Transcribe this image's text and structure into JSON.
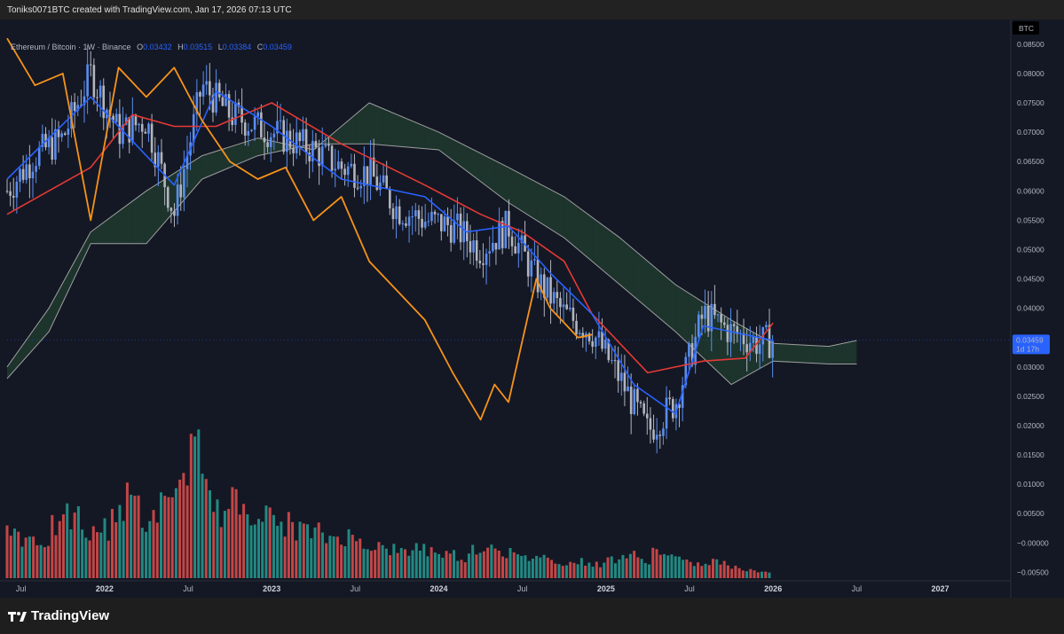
{
  "header": {
    "caption": "Toniks0071BTC created with TradingView.com, Jan 17, 2026 07:13 UTC"
  },
  "legend": {
    "symbol": "Ethereum / Bitcoin · 1W · Binance",
    "o_label": "O",
    "o": "0.03432",
    "h_label": "H",
    "h": "0.03515",
    "l_label": "L",
    "l": "0.03384",
    "c_label": "C",
    "c": "0.03459"
  },
  "price_axis": {
    "currency": "BTC",
    "ticks": [
      "0.08500",
      "0.08000",
      "0.07500",
      "0.07000",
      "0.06500",
      "0.06000",
      "0.05500",
      "0.05000",
      "0.04500",
      "0.04000",
      "0.03500",
      "0.03000",
      "0.02500",
      "0.02000",
      "0.01500",
      "0.01000",
      "0.00500",
      "−0.00000",
      "−0.00500"
    ],
    "last_price_label": "0.03459",
    "countdown_label": "1d 17h"
  },
  "time_axis": {
    "ticks": [
      {
        "label": "Jul",
        "year": false
      },
      {
        "label": "2022",
        "year": true
      },
      {
        "label": "Jul",
        "year": false
      },
      {
        "label": "2023",
        "year": true
      },
      {
        "label": "Jul",
        "year": false
      },
      {
        "label": "2024",
        "year": true
      },
      {
        "label": "Jul",
        "year": false
      },
      {
        "label": "2025",
        "year": true
      },
      {
        "label": "Jul",
        "year": false
      },
      {
        "label": "2026",
        "year": true
      },
      {
        "label": "Jul",
        "year": false
      },
      {
        "label": "2027",
        "year": true
      }
    ]
  },
  "footer": {
    "brand": "TradingView"
  },
  "colors": {
    "bg": "#141824",
    "up": "#5b8def",
    "down": "#b2b5be",
    "tenkan": "#2962ff",
    "kijun": "#e53935",
    "chikou": "#f7931a",
    "span_line": "#9e9e9e",
    "kumo_bull": "#1e3a2f",
    "kumo_bear": "#4a2431",
    "vol_up": "#26a69a",
    "vol_down": "#ef5350",
    "price_tag": "#2962ff"
  },
  "chart_data": {
    "type": "candlestick-ichimoku",
    "title": "Ethereum / Bitcoin · 1W · Binance",
    "ylabel": "BTC",
    "ylim": [
      -0.006,
      0.088
    ],
    "x_range": [
      "2021-06",
      "2027-06"
    ],
    "last": {
      "open": 0.03432,
      "high": 0.03515,
      "low": 0.03384,
      "close": 0.03459
    },
    "close_path": [
      [
        "2021-06",
        0.06
      ],
      [
        "2021-08",
        0.066
      ],
      [
        "2021-10",
        0.069
      ],
      [
        "2021-12",
        0.08
      ],
      [
        "2022-02",
        0.07
      ],
      [
        "2022-04",
        0.072
      ],
      [
        "2022-06",
        0.056
      ],
      [
        "2022-08",
        0.078
      ],
      [
        "2022-10",
        0.073
      ],
      [
        "2022-12",
        0.071
      ],
      [
        "2023-02",
        0.069
      ],
      [
        "2023-04",
        0.067
      ],
      [
        "2023-06",
        0.064
      ],
      [
        "2023-08",
        0.063
      ],
      [
        "2023-10",
        0.057
      ],
      [
        "2023-12",
        0.055
      ],
      [
        "2024-02",
        0.054
      ],
      [
        "2024-04",
        0.05
      ],
      [
        "2024-06",
        0.054
      ],
      [
        "2024-08",
        0.045
      ],
      [
        "2024-10",
        0.039
      ],
      [
        "2024-12",
        0.036
      ],
      [
        "2025-02",
        0.028
      ],
      [
        "2025-04",
        0.019
      ],
      [
        "2025-06",
        0.024
      ],
      [
        "2025-08",
        0.039
      ],
      [
        "2025-10",
        0.036
      ],
      [
        "2025-12",
        0.034
      ],
      [
        "2026-01",
        0.0346
      ]
    ],
    "tenkan": [
      [
        "2021-06",
        0.062
      ],
      [
        "2021-12",
        0.076
      ],
      [
        "2022-06",
        0.061
      ],
      [
        "2022-09",
        0.077
      ],
      [
        "2023-01",
        0.071
      ],
      [
        "2023-06",
        0.062
      ],
      [
        "2023-12",
        0.059
      ],
      [
        "2024-03",
        0.053
      ],
      [
        "2024-06",
        0.054
      ],
      [
        "2024-09",
        0.046
      ],
      [
        "2024-12",
        0.039
      ],
      [
        "2025-03",
        0.027
      ],
      [
        "2025-06",
        0.022
      ],
      [
        "2025-08",
        0.037
      ],
      [
        "2025-10",
        0.036
      ],
      [
        "2026-01",
        0.0345
      ]
    ],
    "kijun": [
      [
        "2021-06",
        0.056
      ],
      [
        "2021-12",
        0.064
      ],
      [
        "2022-03",
        0.073
      ],
      [
        "2022-06",
        0.071
      ],
      [
        "2022-09",
        0.071
      ],
      [
        "2023-01",
        0.075
      ],
      [
        "2023-06",
        0.068
      ],
      [
        "2023-12",
        0.061
      ],
      [
        "2024-04",
        0.056
      ],
      [
        "2024-07",
        0.053
      ],
      [
        "2024-10",
        0.048
      ],
      [
        "2024-12",
        0.039
      ],
      [
        "2025-04",
        0.029
      ],
      [
        "2025-08",
        0.031
      ],
      [
        "2025-11",
        0.0315
      ],
      [
        "2026-01",
        0.0375
      ]
    ],
    "chikou": [
      [
        "2021-06",
        0.086
      ],
      [
        "2021-08",
        0.078
      ],
      [
        "2021-10",
        0.08
      ],
      [
        "2021-12",
        0.055
      ],
      [
        "2022-02",
        0.081
      ],
      [
        "2022-04",
        0.076
      ],
      [
        "2022-06",
        0.081
      ],
      [
        "2022-08",
        0.072
      ],
      [
        "2022-10",
        0.065
      ],
      [
        "2022-12",
        0.062
      ],
      [
        "2023-02",
        0.064
      ],
      [
        "2023-04",
        0.055
      ],
      [
        "2023-06",
        0.059
      ],
      [
        "2023-08",
        0.048
      ],
      [
        "2023-10",
        0.043
      ],
      [
        "2023-12",
        0.038
      ],
      [
        "2024-02",
        0.029
      ],
      [
        "2024-04",
        0.021
      ],
      [
        "2024-05",
        0.027
      ],
      [
        "2024-06",
        0.024
      ],
      [
        "2024-08",
        0.045
      ],
      [
        "2024-09",
        0.04
      ],
      [
        "2024-11",
        0.035
      ],
      [
        "2024-12",
        0.0355
      ]
    ],
    "senkou_a": [
      [
        "2021-06",
        0.03
      ],
      [
        "2021-09",
        0.04
      ],
      [
        "2021-12",
        0.053
      ],
      [
        "2022-04",
        0.06
      ],
      [
        "2022-08",
        0.066
      ],
      [
        "2022-12",
        0.069
      ],
      [
        "2023-04",
        0.067
      ],
      [
        "2023-08",
        0.075
      ],
      [
        "2024-01",
        0.07
      ],
      [
        "2024-06",
        0.064
      ],
      [
        "2024-10",
        0.059
      ],
      [
        "2025-02",
        0.052
      ],
      [
        "2025-06",
        0.044
      ],
      [
        "2025-10",
        0.038
      ],
      [
        "2026-01",
        0.034
      ],
      [
        "2026-05",
        0.0335
      ],
      [
        "2026-07",
        0.0345
      ]
    ],
    "senkou_b": [
      [
        "2021-06",
        0.028
      ],
      [
        "2021-09",
        0.036
      ],
      [
        "2021-12",
        0.051
      ],
      [
        "2022-04",
        0.051
      ],
      [
        "2022-08",
        0.062
      ],
      [
        "2022-12",
        0.066
      ],
      [
        "2023-04",
        0.068
      ],
      [
        "2023-08",
        0.068
      ],
      [
        "2024-01",
        0.067
      ],
      [
        "2024-06",
        0.058
      ],
      [
        "2024-10",
        0.052
      ],
      [
        "2025-02",
        0.044
      ],
      [
        "2025-06",
        0.036
      ],
      [
        "2025-10",
        0.027
      ],
      [
        "2026-01",
        0.031
      ],
      [
        "2026-05",
        0.0305
      ],
      [
        "2026-07",
        0.0305
      ]
    ],
    "volume_relative": [
      0.31,
      0.27,
      0.25,
      0.34,
      0.4,
      0.29,
      0.33,
      0.45,
      0.52,
      0.38,
      0.47,
      0.62,
      0.81,
      0.58,
      0.43,
      0.49,
      0.46,
      0.4,
      0.36,
      0.33,
      0.3,
      0.27,
      0.28,
      0.25,
      0.22,
      0.19,
      0.17,
      0.21,
      0.18,
      0.16,
      0.14,
      0.2,
      0.22,
      0.17,
      0.13,
      0.15,
      0.12,
      0.1,
      0.11,
      0.09,
      0.13,
      0.15,
      0.12,
      0.18,
      0.14,
      0.1,
      0.09,
      0.11,
      0.07,
      0.06,
      0.04
    ]
  }
}
